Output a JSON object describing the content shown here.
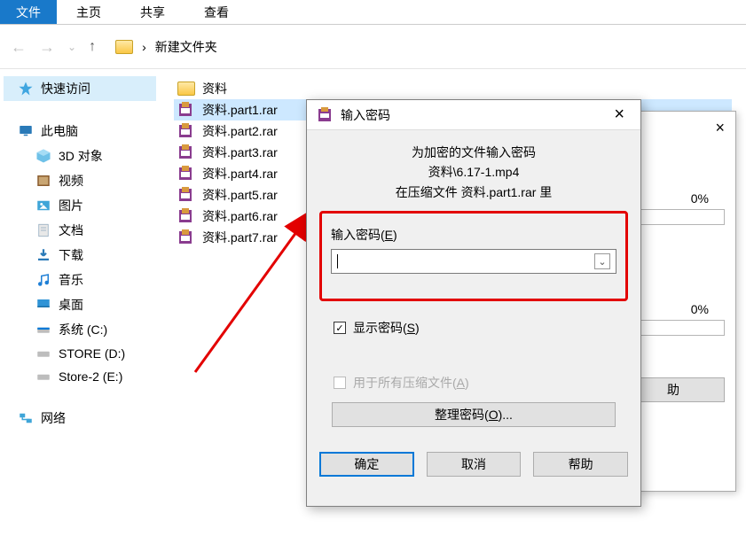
{
  "ribbon": {
    "file": "文件",
    "tabs": [
      "主页",
      "共享",
      "查看"
    ]
  },
  "breadcrumb": {
    "sep": "›",
    "folder": "新建文件夹"
  },
  "sidebar": {
    "quick": {
      "label": "快速访问"
    },
    "thispc": {
      "label": "此电脑"
    },
    "items": [
      {
        "label": "3D 对象"
      },
      {
        "label": "视频"
      },
      {
        "label": "图片"
      },
      {
        "label": "文档"
      },
      {
        "label": "下载"
      },
      {
        "label": "音乐"
      },
      {
        "label": "桌面"
      },
      {
        "label": "系统 (C:)"
      },
      {
        "label": "STORE (D:)"
      },
      {
        "label": "Store-2 (E:)"
      }
    ],
    "network": {
      "label": "网络"
    }
  },
  "files": {
    "folder": {
      "name": "资料"
    },
    "rows": [
      {
        "name": "资料.part1.rar"
      },
      {
        "name": "资料.part2.rar"
      },
      {
        "name": "资料.part3.rar"
      },
      {
        "name": "资料.part4.rar"
      },
      {
        "name": "资料.part5.rar"
      },
      {
        "name": "资料.part6.rar"
      },
      {
        "name": "资料.part7.rar"
      }
    ]
  },
  "backDialog": {
    "pct1": "0%",
    "pct2": "0%",
    "help": "助"
  },
  "dialog": {
    "title": "输入密码",
    "msg1": "为加密的文件输入密码",
    "msg2": "资料\\6.17-1.mp4",
    "msg3": "在压缩文件 资料.part1.rar 里",
    "field_label_pre": "输入密码(",
    "field_label_u": "E",
    "field_label_post": ")",
    "show_pre": "显示密码(",
    "show_u": "S",
    "show_post": ")",
    "all_pre": "用于所有压缩文件(",
    "all_u": "A",
    "all_post": ")",
    "org_pre": "整理密码(",
    "org_u": "O",
    "org_post": ")...",
    "ok": "确定",
    "cancel": "取消",
    "help": "帮助"
  }
}
